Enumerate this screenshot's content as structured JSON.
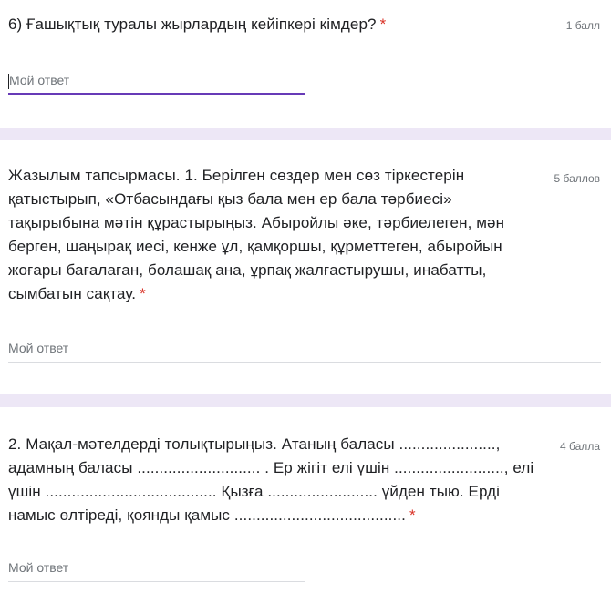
{
  "questions": [
    {
      "text": "6) Ғашықтық туралы жырлардың кейіпкері кімдер?",
      "required_mark": "*",
      "points": "1 балл",
      "answer_placeholder": "Мой ответ"
    },
    {
      "text": "Жазылым тапсырмасы. 1. Берілген сөздер мен сөз тіркестерін қатыстырып, «Отбасындағы қыз бала мен ер бала тәрбиесі» тақырыбына мәтін құрастырыңыз. Абыройлы әке, тәрбиелеген, мән берген, шаңырақ иесі, кенже ұл, қамқоршы, құрметтеген, абыройын жоғары бағалаған, болашақ ана, ұрпақ жалғастырушы, инабатты, сымбатын сақтау.",
      "required_mark": "*",
      "points": "5 баллов",
      "answer_placeholder": "Мой ответ"
    },
    {
      "text": "2. Мақал-мәтелдерді толықтырыңыз. Атаның баласы ......................, адамның баласы ............................ . Ер жігіт елі үшін ........................., елі үшін ....................................... Қызға ......................... үйден тыю. Ерді намыс өлтіреді, қоянды қамыс .......................................",
      "required_mark": "*",
      "points": "4 балла",
      "answer_placeholder": "Мой ответ"
    }
  ]
}
